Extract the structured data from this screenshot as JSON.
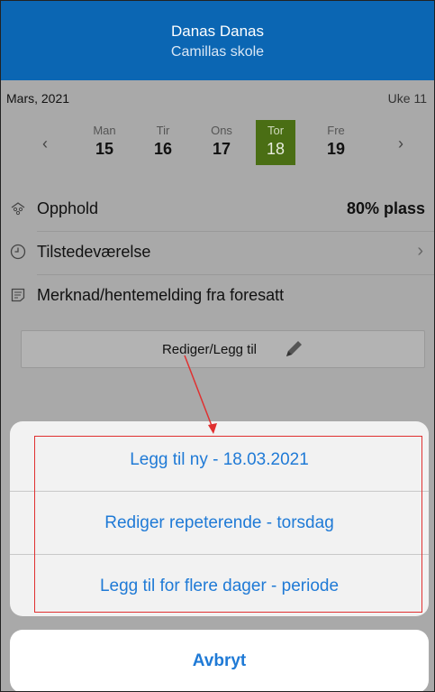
{
  "header": {
    "name": "Danas Danas",
    "school": "Camillas skole"
  },
  "calendar": {
    "month": "Mars, 2021",
    "week": "Uke 11",
    "prev_icon": "chevron-left-icon",
    "next_icon": "chevron-right-icon",
    "days": [
      {
        "name": "Man",
        "date": "15"
      },
      {
        "name": "Tir",
        "date": "16"
      },
      {
        "name": "Ons",
        "date": "17"
      },
      {
        "name": "Tor",
        "date": "18"
      },
      {
        "name": "Fre",
        "date": "19"
      }
    ],
    "selected_day": "Tor",
    "selected_color": "#4a6e14"
  },
  "rows": {
    "stay": {
      "label": "Opphold",
      "value": "80% plass",
      "icon": "people-icon"
    },
    "attendance": {
      "label": "Tilstedeværelse",
      "icon": "clock-icon"
    },
    "note": {
      "label": "Merknad/hentemelding fra foresatt",
      "icon": "note-icon"
    }
  },
  "edit_button": {
    "label": "Rediger/Legg til",
    "icon": "pencil-icon"
  },
  "action_sheet": {
    "options": [
      "Legg til ny - 18.03.2021",
      "Rediger repeterende - torsdag",
      "Legg til for flere dager - periode"
    ],
    "cancel": "Avbryt"
  },
  "colors": {
    "header_bg": "#0b66b3",
    "link": "#1f7ad6",
    "annotation": "#e03030"
  }
}
